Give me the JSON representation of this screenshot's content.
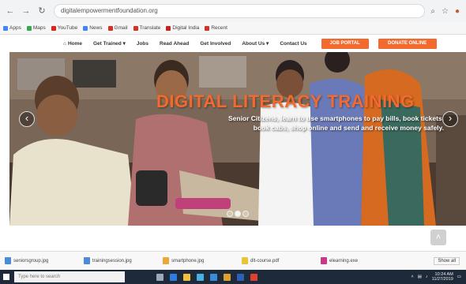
{
  "browser": {
    "url": "digitalempowermentfoundation.org",
    "bookmarks": [
      "Apps",
      "Maps",
      "YouTube",
      "News",
      "Gmail",
      "Translate",
      "Digital India",
      "Recent"
    ]
  },
  "site_nav": {
    "home": "Home",
    "links": [
      "Get Trained ▾",
      "Jobs",
      "Read Ahead",
      "Get Involved",
      "About Us ▾",
      "Contact Us"
    ],
    "job_portal": "JOB PORTAL",
    "donate": "DONATE ONLINE"
  },
  "hero": {
    "title": "DIGITAL LITERACY TRAINING",
    "subtitle_line1": "Senior Citizens, learn to use smartphones to pay bills, book tickets,",
    "subtitle_line2": "book cabs, shop online and send and receive money safely.",
    "slide_count": 3,
    "active_slide": 1
  },
  "downloads": {
    "items": [
      "seniorsgroup.jpg",
      "trainingsession.jpg",
      "smartphone.jpg",
      "dlt-course.pdf",
      "elearning.exe"
    ],
    "show_all": "Show all"
  },
  "taskbar": {
    "search_placeholder": "Type here to search",
    "time": "10:24 AM",
    "date": "11/27/2019"
  },
  "colors": {
    "accent": "#f26a2e",
    "taskbar": "#1e2a3a"
  }
}
